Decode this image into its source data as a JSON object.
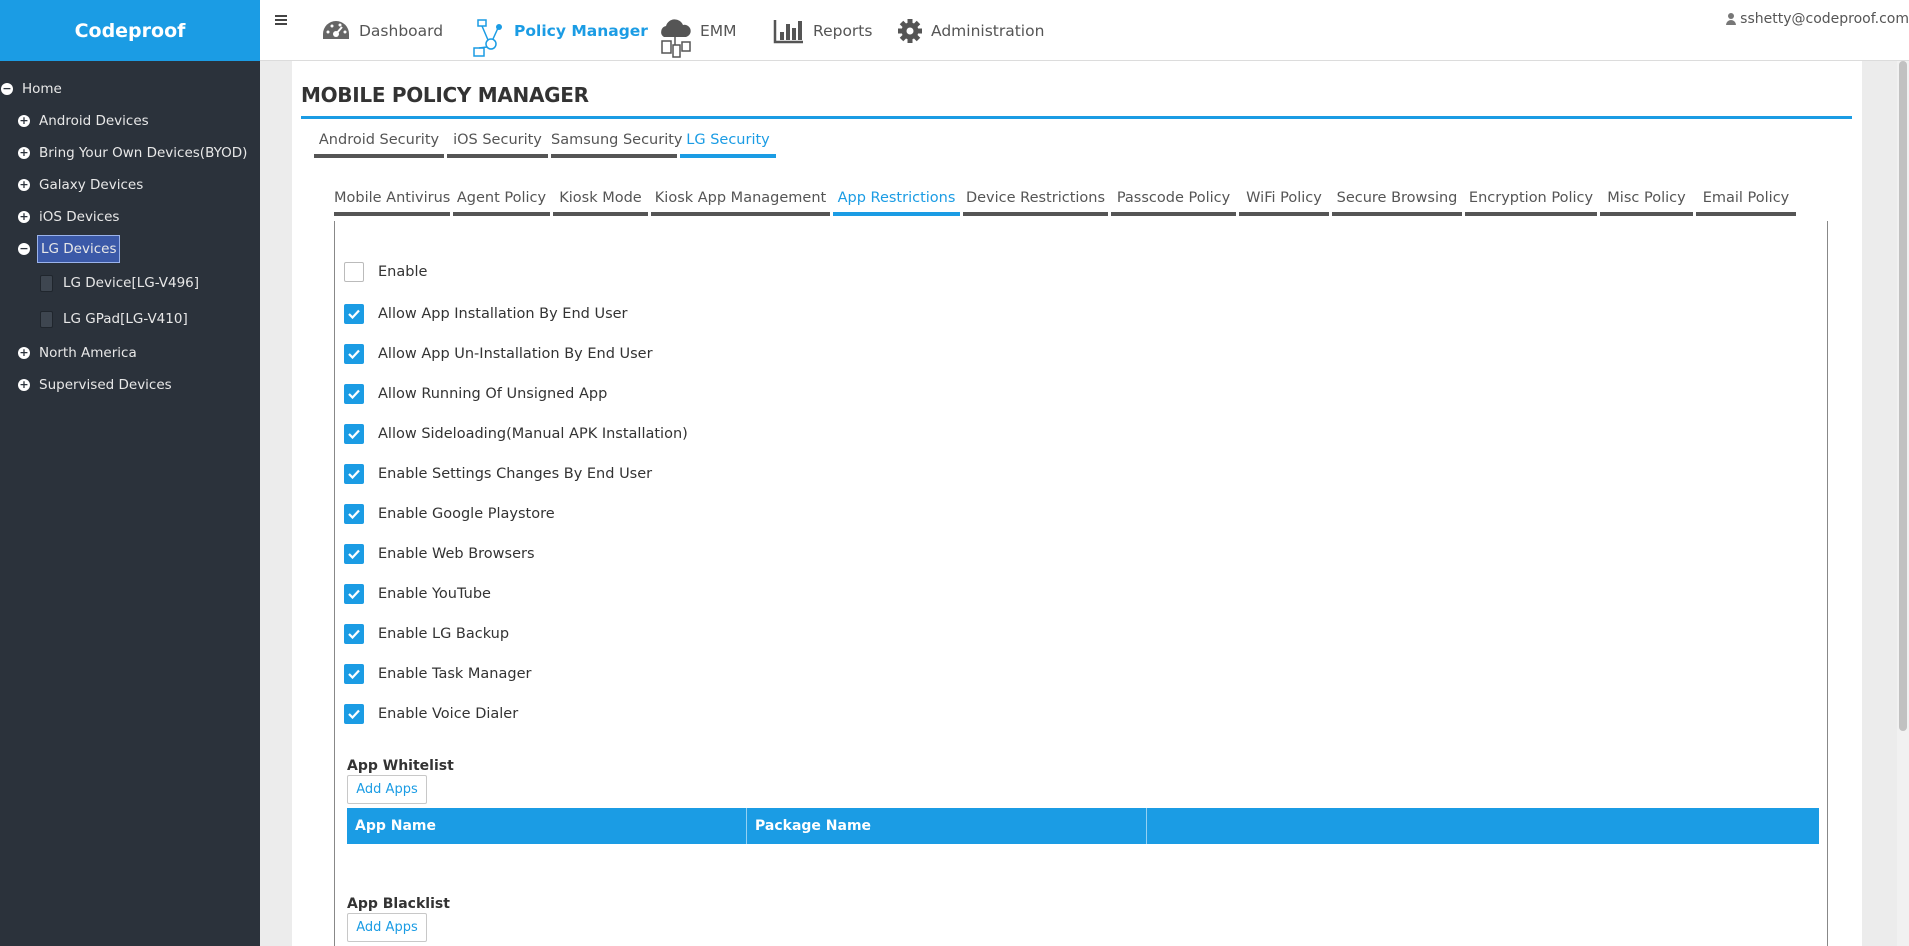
{
  "brand": "Codeproof",
  "sidebar": {
    "tree": [
      {
        "label": "Home",
        "toggle": "−",
        "level": "root"
      },
      {
        "label": "Android Devices",
        "toggle": "+",
        "level": "lvl1"
      },
      {
        "label": "Bring Your Own Devices(BYOD)",
        "toggle": "+",
        "level": "lvl1"
      },
      {
        "label": "Galaxy Devices",
        "toggle": "+",
        "level": "lvl1"
      },
      {
        "label": "iOS Devices",
        "toggle": "+",
        "level": "lvl1"
      },
      {
        "label": "LG Devices",
        "toggle": "−",
        "level": "lvl1",
        "selected": true
      },
      {
        "label": "LG Device[LG-V496]",
        "level": "lvl2"
      },
      {
        "label": "LG GPad[LG-V410]",
        "level": "lvl2"
      },
      {
        "label": "North America",
        "toggle": "+",
        "level": "lvl1"
      },
      {
        "label": "Supervised Devices",
        "toggle": "+",
        "level": "lvl1"
      }
    ]
  },
  "topnav": {
    "items": [
      {
        "label": "Dashboard",
        "icon": "dashboard-icon"
      },
      {
        "label": "Policy Manager",
        "icon": "policy-manager-icon",
        "active": true
      },
      {
        "label": "EMM",
        "icon": "cloud-devices-icon"
      },
      {
        "label": "Reports",
        "icon": "bar-chart-icon"
      },
      {
        "label": "Administration",
        "icon": "gear-icon"
      }
    ],
    "user": "sshetty@codeproof.com"
  },
  "page": {
    "title": "MOBILE POLICY MANAGER",
    "platform_tabs": [
      {
        "label": "Android Security"
      },
      {
        "label": "iOS Security"
      },
      {
        "label": "Samsung Security"
      },
      {
        "label": "LG Security",
        "active": true
      }
    ],
    "policy_tabs": [
      {
        "label": "Mobile Antivirus"
      },
      {
        "label": "Agent Policy"
      },
      {
        "label": "Kiosk Mode"
      },
      {
        "label": "Kiosk App Management"
      },
      {
        "label": "App Restrictions",
        "active": true
      },
      {
        "label": "Device Restrictions"
      },
      {
        "label": "Passcode Policy"
      },
      {
        "label": "WiFi Policy"
      },
      {
        "label": "Secure Browsing"
      },
      {
        "label": "Encryption Policy"
      },
      {
        "label": "Misc Policy"
      },
      {
        "label": "Email Policy"
      }
    ],
    "options": [
      {
        "label": "Enable",
        "checked": false
      },
      {
        "label": "Allow App Installation By End User",
        "checked": true
      },
      {
        "label": "Allow App Un-Installation By End User",
        "checked": true
      },
      {
        "label": "Allow Running Of Unsigned App",
        "checked": true
      },
      {
        "label": "Allow Sideloading(Manual APK Installation)",
        "checked": true
      },
      {
        "label": "Enable Settings Changes By End User",
        "checked": true
      },
      {
        "label": "Enable Google Playstore",
        "checked": true
      },
      {
        "label": "Enable Web Browsers",
        "checked": true
      },
      {
        "label": "Enable YouTube",
        "checked": true
      },
      {
        "label": "Enable LG Backup",
        "checked": true
      },
      {
        "label": "Enable Task Manager",
        "checked": true
      },
      {
        "label": "Enable Voice Dialer",
        "checked": true
      }
    ],
    "whitelist": {
      "label": "App Whitelist",
      "add_label": "Add Apps",
      "columns": [
        "App Name",
        "Package Name",
        ""
      ]
    },
    "blacklist": {
      "label": "App Blacklist",
      "add_label": "Add Apps"
    }
  }
}
